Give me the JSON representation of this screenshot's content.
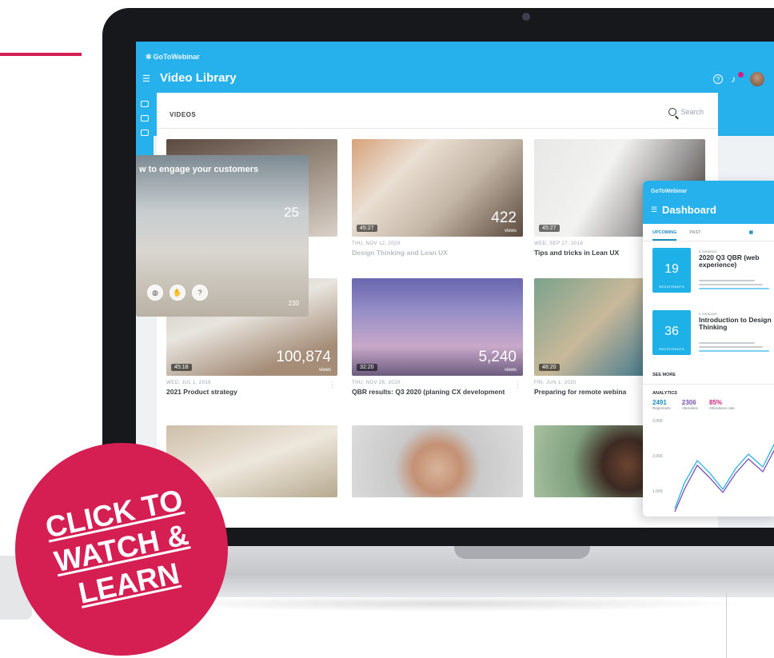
{
  "accent_color": "#d51f53",
  "app_brand": "GoToWebinar",
  "page_title": "Video Library",
  "videos_label": "VIDEOS",
  "search_label": "Search",
  "popup": {
    "title": "w to engage your customers",
    "views": "25",
    "count": "230"
  },
  "cards": [
    {
      "meta": "",
      "title": "",
      "duration": "",
      "views": "",
      "faded": false
    },
    {
      "meta": "THU, NOV 12, 2020",
      "title": "Design Thinking and Lean UX",
      "duration": "45:27",
      "views": "422",
      "faded": true
    },
    {
      "meta": "WED, SEP 27, 2019",
      "title": "Tips and tricks in Lean UX",
      "duration": "45:27",
      "views": "",
      "faded": false
    },
    {
      "meta": "WED, JUL 1, 2019",
      "title": "2021 Product strategy",
      "duration": "45:18",
      "views": "100,874",
      "faded": false
    },
    {
      "meta": "THU, NOV 26, 2020",
      "title": "QBR results: Q3 2020 (planing CX development",
      "duration": "32:20",
      "views": "5,240",
      "faded": false
    },
    {
      "meta": "FRI, JUN 1, 2020",
      "title": "Preparing for remote webina",
      "duration": "48:20",
      "views": "",
      "faded": false
    }
  ],
  "views_unit": "views",
  "dashboard": {
    "brand": "GoToWebinar",
    "title": "Dashboard",
    "tabs": [
      "UPCOMING",
      "PAST"
    ],
    "events": [
      {
        "day": "19",
        "sub": "REGISTRANTS",
        "type": "E-WEBINAR",
        "name": "2020 Q3 QBR (web experience)"
      },
      {
        "day": "36",
        "sub": "REGISTRANTS",
        "type": "E-WEBINAR",
        "name": "Introduction to Design Thinking"
      }
    ],
    "see_more": "SEE MORE",
    "analytics_title": "ANALYTICS",
    "stats": [
      {
        "value": "2491",
        "label": "Registrants",
        "color": "#1e8fbf"
      },
      {
        "value": "2306",
        "label": "Attendees",
        "color": "#7a4fb3"
      },
      {
        "value": "85%",
        "label": "Attendance rate",
        "color": "#d21e7e"
      }
    ],
    "chart_ticks": [
      "3,000",
      "2,000",
      "1,000"
    ]
  },
  "cta": {
    "line1": "CLICK TO",
    "line2": "WATCH &",
    "line3": "LEARN"
  }
}
